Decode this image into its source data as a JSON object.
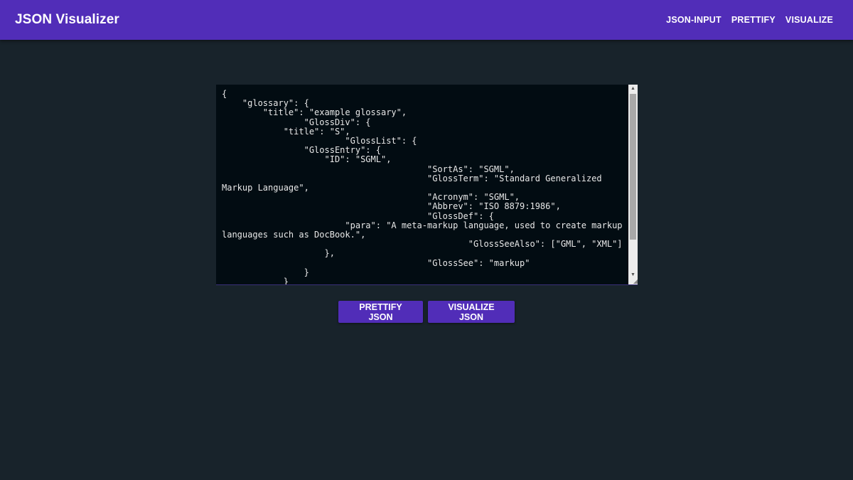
{
  "app": {
    "title": "JSON Visualizer"
  },
  "nav": {
    "items": [
      {
        "label": "JSON-INPUT"
      },
      {
        "label": "PRETTIFY"
      },
      {
        "label": "VISUALIZE"
      }
    ]
  },
  "editor": {
    "value": "{\n    \"glossary\": {\n        \"title\": \"example glossary\",\n                \"GlossDiv\": {\n            \"title\": \"S\",\n                        \"GlossList\": {\n                \"GlossEntry\": {\n                    \"ID\": \"SGML\",\n                                        \"SortAs\": \"SGML\",\n                                        \"GlossTerm\": \"Standard Generalized\nMarkup Language\",\n                                        \"Acronym\": \"SGML\",\n                                        \"Abbrev\": \"ISO 8879:1986\",\n                                        \"GlossDef\": {\n                        \"para\": \"A meta-markup language, used to create markup\nlanguages such as DocBook.\",\n                                                \"GlossSeeAlso\": [\"GML\", \"XML\"]\n                    },\n                                        \"GlossSee\": \"markup\"\n                }\n            }"
  },
  "actions": {
    "prettify_label": "PRETTIFY JSON",
    "visualize_label": "VISUALIZE JSON"
  },
  "colors": {
    "accent": "#512db8",
    "background": "#18232b",
    "editor_background": "#020c12"
  }
}
